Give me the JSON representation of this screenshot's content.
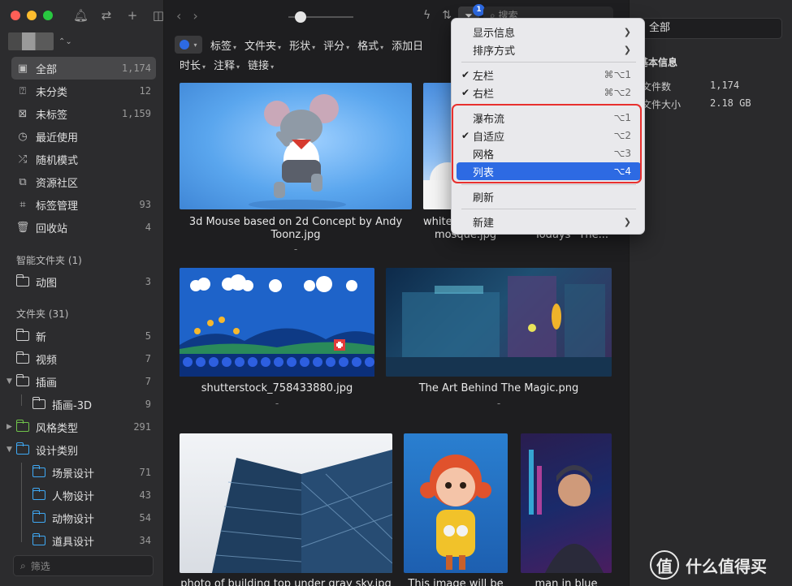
{
  "sidebar": {
    "top_icons": [
      "bell-icon",
      "sync-icon",
      "plus-icon",
      "sidebar-toggle-icon"
    ],
    "nav": [
      {
        "label": "全部",
        "count": "1,174",
        "icon": "tray-icon"
      },
      {
        "label": "未分类",
        "count": "12",
        "icon": "question-box-icon"
      },
      {
        "label": "未标签",
        "count": "1,159",
        "icon": "untagged-icon"
      },
      {
        "label": "最近使用",
        "count": "",
        "icon": "clock-icon"
      },
      {
        "label": "随机模式",
        "count": "",
        "icon": "shuffle-icon"
      },
      {
        "label": "资源社区",
        "count": "",
        "icon": "community-icon"
      },
      {
        "label": "标签管理",
        "count": "93",
        "icon": "tag-icon"
      },
      {
        "label": "回收站",
        "count": "4",
        "icon": "trash-icon"
      }
    ],
    "smart_title": "智能文件夹 (1)",
    "smart_folders": [
      {
        "label": "动图",
        "count": "3"
      }
    ],
    "folders_title": "文件夹 (31)",
    "folders": [
      {
        "label": "新",
        "count": "5"
      },
      {
        "label": "视频",
        "count": "7"
      },
      {
        "label": "插画",
        "count": "7"
      },
      {
        "label": "插画-3D",
        "count": "9"
      },
      {
        "label": "风格类型",
        "count": "291"
      },
      {
        "label": "设计类别",
        "count": ""
      },
      {
        "label": "场景设计",
        "count": "71"
      },
      {
        "label": "人物设计",
        "count": "43"
      },
      {
        "label": "动物设计",
        "count": "54"
      },
      {
        "label": "道具设计",
        "count": "34"
      }
    ],
    "filter_placeholder": "筛选"
  },
  "topbar": {
    "search_placeholder": "搜索",
    "badge": "1"
  },
  "filters": {
    "row1": [
      "标签",
      "文件夹",
      "形状",
      "评分",
      "格式",
      "添加日"
    ],
    "row2": [
      "时长",
      "注释",
      "链接"
    ]
  },
  "items": [
    {
      "caption": "3d Mouse based on 2d Concept by Andy Toonz.jpg",
      "sub": "-"
    },
    {
      "caption": "white mosque.jpg",
      "sub": "-"
    },
    {
      "caption": "Todays \"The...",
      "sub": ""
    },
    {
      "caption": "shutterstock_758433880.jpg",
      "sub": "-"
    },
    {
      "caption": "The Art Behind The Magic.png",
      "sub": "-"
    },
    {
      "caption": "photo of building top under gray sky.jpg",
      "sub": ""
    },
    {
      "caption": "This image will be",
      "sub": ""
    },
    {
      "caption": "man in blue",
      "sub": ""
    }
  ],
  "right_panel": {
    "scope": "全部",
    "section": "基本信息",
    "rows": [
      {
        "k": "文件数",
        "v": "1,174"
      },
      {
        "k": "文件大小",
        "v": "2.18 GB"
      }
    ],
    "watermark": "什么值得买",
    "watermark_glyph": "值"
  },
  "menu": {
    "items": [
      {
        "label": "显示信息",
        "shortcut": "",
        "submenu": true,
        "checked": false
      },
      {
        "label": "排序方式",
        "shortcut": "",
        "submenu": true,
        "checked": false
      },
      {
        "label": "左栏",
        "shortcut": "⌘⌥1",
        "submenu": false,
        "checked": true
      },
      {
        "label": "右栏",
        "shortcut": "⌘⌥2",
        "submenu": false,
        "checked": true
      },
      {
        "label": "瀑布流",
        "shortcut": "⌥1",
        "submenu": false,
        "checked": false
      },
      {
        "label": "自适应",
        "shortcut": "⌥2",
        "submenu": false,
        "checked": true
      },
      {
        "label": "网格",
        "shortcut": "⌥3",
        "submenu": false,
        "checked": false
      },
      {
        "label": "列表",
        "shortcut": "⌥4",
        "submenu": false,
        "checked": false,
        "selected": true
      },
      {
        "label": "刷新",
        "shortcut": "",
        "submenu": false,
        "checked": false
      },
      {
        "label": "新建",
        "shortcut": "",
        "submenu": true,
        "checked": false
      }
    ]
  },
  "colors": {
    "accent": "#2d6ae3",
    "highlight_box": "#e8302e"
  }
}
